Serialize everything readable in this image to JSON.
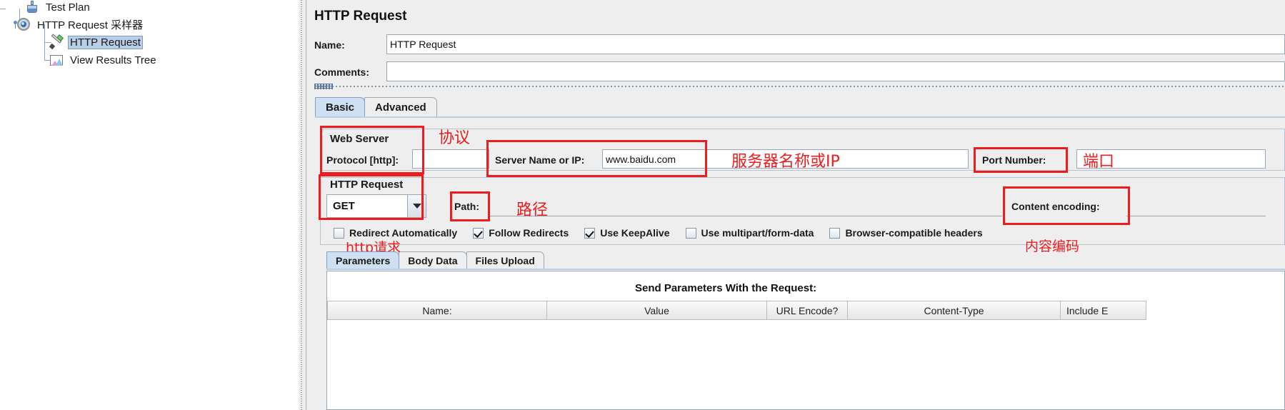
{
  "tree": {
    "nodes": [
      {
        "label": "Test Plan",
        "icon": "flask-icon",
        "selected": false
      },
      {
        "label": "HTTP Request 采样器",
        "icon": "gear-icon",
        "selected": false
      },
      {
        "label": "HTTP Request",
        "icon": "pipette-icon",
        "selected": true
      },
      {
        "label": "View Results Tree",
        "icon": "results-chart-icon",
        "selected": false
      }
    ]
  },
  "panel": {
    "title": "HTTP Request",
    "name_label": "Name:",
    "name_value": "HTTP Request",
    "comments_label": "Comments:",
    "comments_value": "",
    "main_tabs": [
      {
        "label": "Basic",
        "active": true
      },
      {
        "label": "Advanced",
        "active": false
      }
    ]
  },
  "web_server": {
    "group_title": "Web Server",
    "protocol_label": "Protocol [http]:",
    "protocol_value": "",
    "server_label": "Server Name or IP:",
    "server_value": "www.baidu.com",
    "port_label": "Port Number:",
    "port_value": ""
  },
  "http_request": {
    "group_title": "HTTP Request",
    "method_value": "GET",
    "path_label": "Path:",
    "path_value": "",
    "content_encoding_label": "Content encoding:",
    "content_encoding_value": "",
    "checkboxes": [
      {
        "label": "Redirect Automatically",
        "checked": false
      },
      {
        "label": "Follow Redirects",
        "checked": true
      },
      {
        "label": "Use KeepAlive",
        "checked": true
      },
      {
        "label": "Use multipart/form-data",
        "checked": false
      },
      {
        "label": "Browser-compatible headers",
        "checked": false
      }
    ]
  },
  "param_section": {
    "tabs": [
      {
        "label": "Parameters",
        "active": true
      },
      {
        "label": "Body Data",
        "active": false
      },
      {
        "label": "Files Upload",
        "active": false
      }
    ],
    "send_label": "Send Parameters With the Request:",
    "columns": [
      "Name:",
      "Value",
      "URL Encode?",
      "Content-Type",
      "Include E"
    ]
  },
  "annotations": [
    {
      "id": "protocol",
      "text": "协议"
    },
    {
      "id": "server",
      "text": "服务器名称或IP"
    },
    {
      "id": "port",
      "text": "端口"
    },
    {
      "id": "path",
      "text": "路径"
    },
    {
      "id": "content-encoding",
      "text": "内容编码"
    },
    {
      "id": "http-request",
      "text": "http请求"
    }
  ],
  "colors": {
    "annotation_red": "#ee1c1c",
    "selection_blue": "#b9cfe8",
    "panel_bg": "#eeeeee"
  }
}
